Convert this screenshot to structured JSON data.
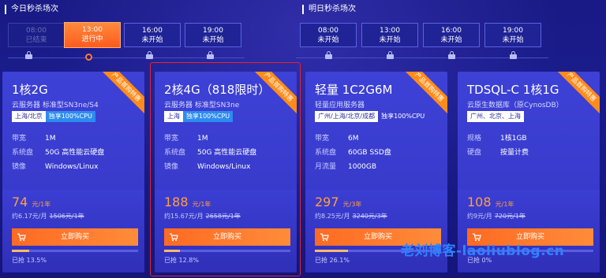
{
  "today_label": "今日秒杀场次",
  "tomorrow_label": "明日秒杀场次",
  "today_slots": [
    {
      "time": "08:00",
      "status": "已结束",
      "state": "ended"
    },
    {
      "time": "13:00",
      "status": "进行中",
      "state": "active"
    },
    {
      "time": "16:00",
      "status": "未开始",
      "state": "pending"
    },
    {
      "time": "19:00",
      "status": "未开始",
      "state": "pending"
    }
  ],
  "tomorrow_slots": [
    {
      "time": "08:00",
      "status": "未开始"
    },
    {
      "time": "13:00",
      "status": "未开始"
    },
    {
      "time": "16:00",
      "status": "未开始"
    },
    {
      "time": "19:00",
      "status": "未开始"
    }
  ],
  "ribbon_text": "产品首购特惠",
  "cards": [
    {
      "title": "1核2G",
      "subtitle": "云服务器 标准型SN3ne/S4",
      "tags": [
        "上海/北京",
        "独享100%CPU"
      ],
      "specs": [
        {
          "key": "带宽",
          "value": "1M"
        },
        {
          "key": "系统盘",
          "value": "50G 高性能云硬盘"
        },
        {
          "key": "镜像",
          "value": "Windows/Linux"
        }
      ],
      "price": "74",
      "price_unit": "元/1年",
      "per_month": "约6.17元/月",
      "original": "1506元/1年",
      "buy": "立即购买",
      "sold": "已抢 13.5%",
      "progress": 0.135
    },
    {
      "title": "2核4G（818限时）",
      "subtitle": "云服务器 标准型SN3ne",
      "tags": [
        "上海",
        "独享100%CPU"
      ],
      "specs": [
        {
          "key": "带宽",
          "value": "1M"
        },
        {
          "key": "系统盘",
          "value": "50G 高性能云硬盘"
        },
        {
          "key": "镜像",
          "value": "Windows/Linux"
        }
      ],
      "price": "188",
      "price_unit": "元/1年",
      "per_month": "约15.67元/月",
      "original": "2658元/1年",
      "buy": "立即购买",
      "sold": "已抢 12.8%",
      "progress": 0.128
    },
    {
      "title": "轻量 1C2G6M",
      "subtitle": "轻量应用服务器",
      "tags": [
        "广州/上海/北京/成都",
        "独享100%CPU"
      ],
      "specs": [
        {
          "key": "带宽",
          "value": "6M"
        },
        {
          "key": "系统盘",
          "value": "60GB SSD盘"
        },
        {
          "key": "月流量",
          "value": "1000GB"
        }
      ],
      "price": "297",
      "price_unit": "元/3年",
      "per_month": "约8.25元/月",
      "original": "3240元/3年",
      "buy": "立即购买",
      "sold": "已抢 26.1%",
      "progress": 0.261
    },
    {
      "title": "TDSQL-C 1核1G",
      "subtitle": "云原生数据库（原CynosDB）",
      "tags": [
        "广州、北京、上海"
      ],
      "specs": [
        {
          "key": "规格",
          "value": "1核1GB"
        },
        {
          "key": "硬盘",
          "value": "按量计费"
        }
      ],
      "price": "108",
      "price_unit": "元/1年",
      "per_month": "约9元/月",
      "original": "720元/1年",
      "buy": "立即购买",
      "sold": "已抢 0%",
      "progress": 0.0
    }
  ],
  "watermark": "老刘博客-laoliublog.cn",
  "colors": {
    "accent": "#ff6a23",
    "price": "#ff9f43",
    "background": "#17167a",
    "highlight": "#e5252a"
  }
}
